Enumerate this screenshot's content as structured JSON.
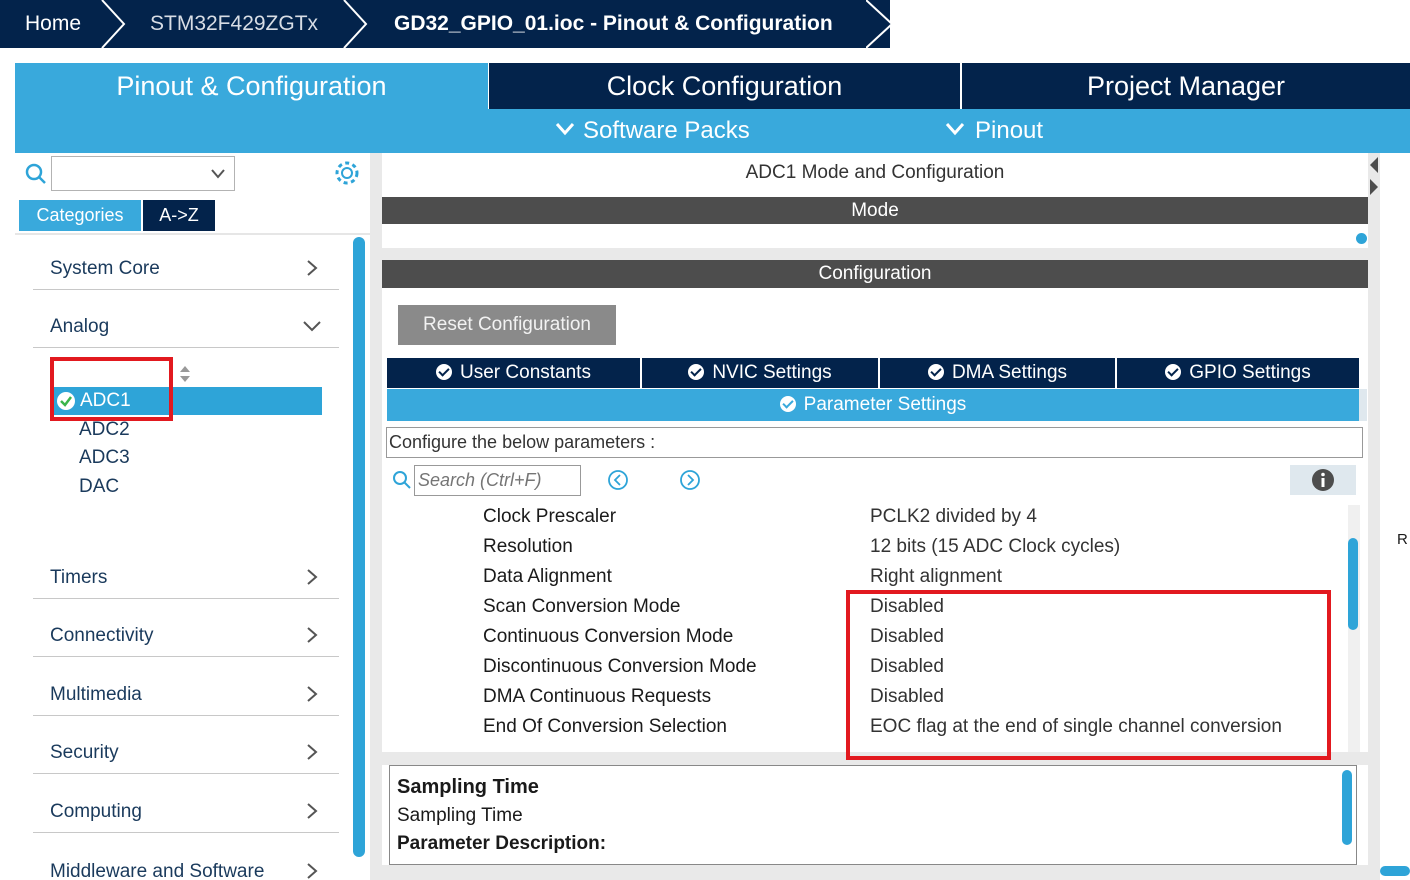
{
  "breadcrumb": {
    "home": "Home",
    "mcu": "STM32F429ZGTx",
    "file": "GD32_GPIO_01.ioc - Pinout & Configuration"
  },
  "main_tabs": [
    "Pinout & Configuration",
    "Clock Configuration",
    "Project Manager"
  ],
  "sub_menu": {
    "software_packs": "Software Packs",
    "pinout": "Pinout"
  },
  "left": {
    "tabs": [
      "Categories",
      "A->Z"
    ],
    "categories": {
      "system_core": "System Core",
      "analog": "Analog",
      "timers": "Timers",
      "connectivity": "Connectivity",
      "multimedia": "Multimedia",
      "security": "Security",
      "computing": "Computing",
      "middleware": "Middleware and Software"
    },
    "analog_items": [
      "ADC1",
      "ADC2",
      "ADC3",
      "DAC"
    ]
  },
  "panel": {
    "title": "ADC1 Mode and Configuration",
    "mode_header": "Mode",
    "config_header": "Configuration",
    "reset_button": "Reset Configuration",
    "tabs": [
      "User Constants",
      "NVIC Settings",
      "DMA Settings",
      "GPIO Settings"
    ],
    "active_tab": "Parameter Settings",
    "configure_text": "Configure the below parameters :",
    "search_placeholder": "Search (Ctrl+F)",
    "params": [
      {
        "name": "Clock Prescaler",
        "value": "PCLK2 divided by 4"
      },
      {
        "name": "Resolution",
        "value": "12 bits (15 ADC Clock cycles)"
      },
      {
        "name": "Data Alignment",
        "value": "Right alignment"
      },
      {
        "name": "Scan Conversion Mode",
        "value": "Disabled"
      },
      {
        "name": "Continuous Conversion Mode",
        "value": "Disabled"
      },
      {
        "name": "Discontinuous Conversion Mode",
        "value": "Disabled"
      },
      {
        "name": "DMA Continuous Requests",
        "value": "Disabled"
      },
      {
        "name": "End Of Conversion Selection",
        "value": "EOC flag at the end of single channel conversion"
      }
    ],
    "desc_title": "Sampling Time",
    "desc_text": "Sampling Time",
    "desc_label": "Parameter Description:"
  },
  "edge_letter": "R",
  "colors": {
    "navy": "#03234b",
    "accent": "#39a9dc",
    "highlight": "#e2191f"
  }
}
